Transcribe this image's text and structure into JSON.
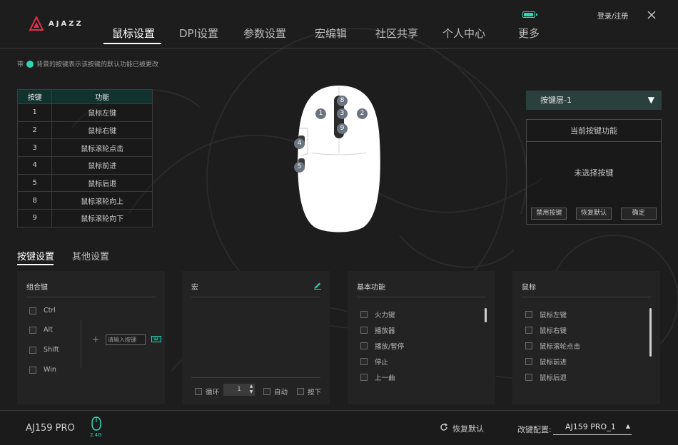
{
  "brand": {
    "logo_text": "AJAZZ",
    "accent_color": "#2fd6b4",
    "logo_color": "#e0304a"
  },
  "nav": {
    "items": [
      "鼠标设置",
      "DPI设置",
      "参数设置",
      "宏编辑",
      "社区共享",
      "个人中心",
      "更多"
    ],
    "active_index": 0
  },
  "header": {
    "login_label": "登录/注册",
    "battery_level": 0.8
  },
  "hint": {
    "prefix": "带",
    "text": "背景的按键表示该按键的默认功能已被更改"
  },
  "mapping_table": {
    "headers": [
      "按键",
      "功能"
    ],
    "rows": [
      [
        "1",
        "鼠标左键"
      ],
      [
        "2",
        "鼠标右键"
      ],
      [
        "3",
        "鼠标滚轮点击"
      ],
      [
        "4",
        "鼠标前进"
      ],
      [
        "5",
        "鼠标后退"
      ],
      [
        "8",
        "鼠标滚轮向上"
      ],
      [
        "9",
        "鼠标滚轮向下"
      ]
    ]
  },
  "mouse_badges": [
    "8",
    "1",
    "3",
    "2",
    "9",
    "4",
    "5"
  ],
  "key_layer": {
    "selected": "按键层-1",
    "arrow": "▼"
  },
  "current_function": {
    "title": "当前按键功能",
    "status": "未选择按键",
    "buttons": [
      "禁用按键",
      "恢复默认",
      "确定"
    ]
  },
  "tabs": {
    "items": [
      "按键设置",
      "其他设置"
    ],
    "active_index": 0
  },
  "panels": {
    "combo": {
      "title": "组合键",
      "modifiers": [
        "Ctrl",
        "Alt",
        "Shift",
        "Win"
      ],
      "plus": "+",
      "input_placeholder": "请输入按键"
    },
    "macro": {
      "title": "宏",
      "loop_label": "循环",
      "loop_value": "1",
      "auto_label": "自动",
      "press_label": "按下"
    },
    "basic": {
      "title": "基本功能",
      "items": [
        "火力键",
        "播放器",
        "播放/暂停",
        "停止",
        "上一曲"
      ]
    },
    "mouse": {
      "title": "鼠标",
      "items": [
        "鼠标左键",
        "鼠标右键",
        "鼠标滚轮点击",
        "鼠标前进",
        "鼠标后退"
      ]
    }
  },
  "footer": {
    "model": "AJ159 PRO",
    "dongle_label": "2.4G",
    "restore_label": "恢复默认",
    "config_label": "改键配置:",
    "config_value": "AJ159 PRO_1",
    "config_arrow": "▲"
  }
}
